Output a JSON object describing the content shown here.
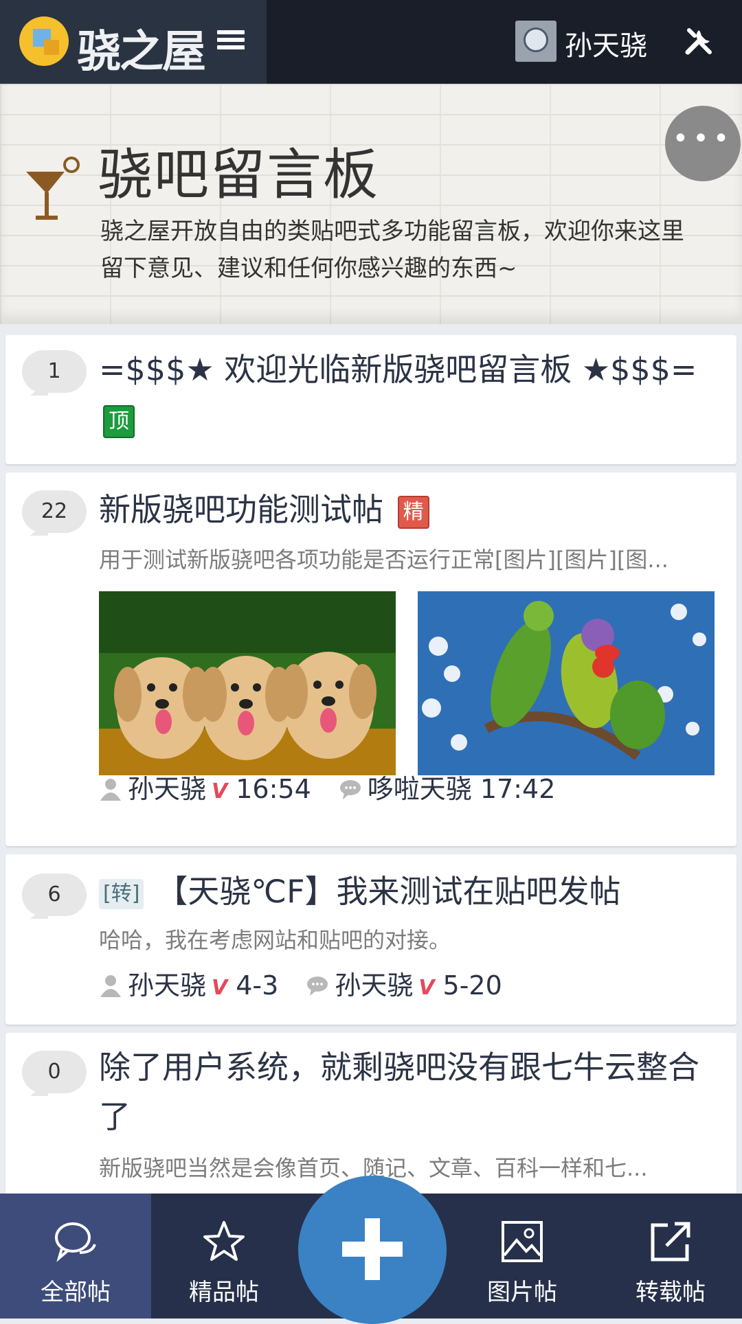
{
  "topbar": {
    "logo_text": "骁之屋",
    "user_name": "孙天骁"
  },
  "header": {
    "title": "骁吧留言板",
    "description": "骁之屋开放自由的类贴吧式多功能留言板，欢迎你来这里留下意见、建议和任何你感兴趣的东西~"
  },
  "posts": [
    {
      "reply_count": "1",
      "title": "=$$$★ 欢迎光临新版骁吧留言板 ★$$$=",
      "tag": "顶"
    },
    {
      "reply_count": "22",
      "title": "新版骁吧功能测试帖",
      "tag": "精",
      "summary": "用于测试新版骁吧各项功能是否运行正常[图片][图片][图...",
      "author": "孙天骁",
      "author_badge": "V",
      "post_time": "16:54",
      "last_replier": "哆啦天骁",
      "reply_time": "17:42"
    },
    {
      "reply_count": "6",
      "prefix_tag": "[转]",
      "title": "【天骁℃F】我来测试在贴吧发帖",
      "summary": "哈哈，我在考虑网站和贴吧的对接。",
      "author": "孙天骁",
      "author_badge": "V",
      "post_time": "4-3",
      "last_replier": "孙天骁",
      "replier_badge": "V",
      "reply_time": "5-20"
    },
    {
      "reply_count": "0",
      "title": "除了用户系统，就剩骁吧没有跟七牛云整合了",
      "summary": "新版骁吧当然是会像首页、随记、文章、百科一样和七..."
    }
  ],
  "bottom_nav": {
    "items": [
      {
        "label": "全部帖",
        "icon": "chat-bubbles-icon"
      },
      {
        "label": "精品帖",
        "icon": "star-icon"
      },
      {
        "label": "图片帖",
        "icon": "image-icon"
      },
      {
        "label": "转载帖",
        "icon": "external-link-icon"
      }
    ]
  },
  "colors": {
    "topbar": "#1a1e29",
    "brand_bg": "#2a3342",
    "tag_top": "#1e9b3d",
    "tag_jing": "#e05a4c",
    "fab": "#3a82c4",
    "nav_bg": "#26304a",
    "nav_active": "#3d4c7a"
  }
}
